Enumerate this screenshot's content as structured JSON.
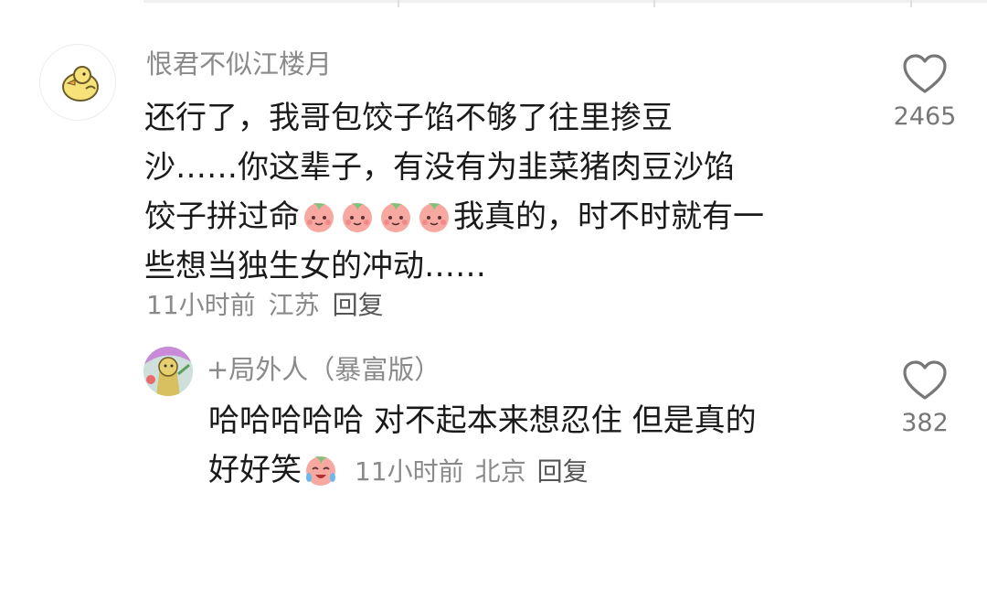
{
  "comments": [
    {
      "username": "恨君不似江楼月",
      "avatar_icon": "chick-icon",
      "lines": [
        "还行了，我哥包饺子馅不够了往里掺豆",
        "沙……你这辈子，有没有为韭菜猪肉豆沙馅",
        "饺子拼过命",
        "我真的，时不时就有一",
        "些想当独生女的冲动……"
      ],
      "time": "11小时前",
      "location": "江苏",
      "reply": "回复",
      "likes": "2465"
    },
    {
      "username": "+局外人（暴富版）",
      "avatar_icon": "cartoon-avatar-icon",
      "lines": [
        "哈哈哈哈哈  对不起本来想忍住  但是真的",
        "好好笑"
      ],
      "time": "11小时前",
      "location": "北京",
      "reply": "回复",
      "likes": "382"
    }
  ],
  "colors": {
    "username": "#8a8a8a",
    "text": "#1a1a1a",
    "meta": "#8a8a8a",
    "emoji_face": "#f7a8a0"
  }
}
